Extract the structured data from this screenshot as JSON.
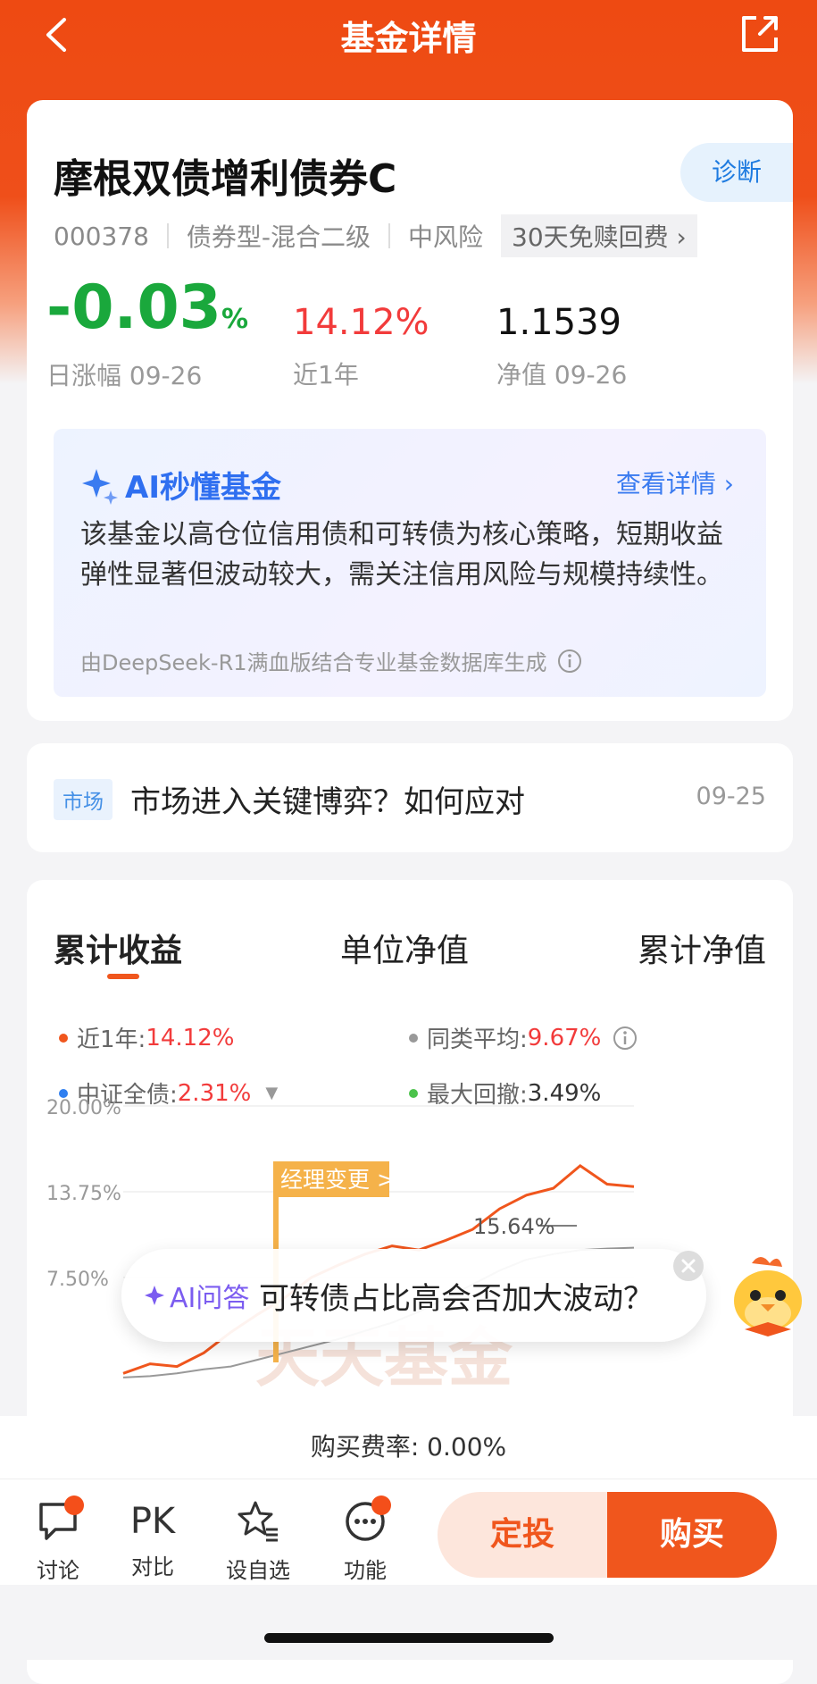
{
  "nav": {
    "title": "基金详情"
  },
  "fund": {
    "name": "摩根双债增利债券C",
    "diagnose_label": "诊断",
    "code": "000378",
    "type": "债券型-混合二级",
    "risk": "中风险",
    "fee_tag": "30天免赎回费",
    "daily_change": "-0.03",
    "daily_change_unit": "%",
    "daily_change_label": "日涨幅 09-26",
    "one_year": "14.12%",
    "one_year_label": "近1年",
    "nav_value": "1.1539",
    "nav_label": "净值 09-26"
  },
  "ai_summary": {
    "title": "AI秒懂基金",
    "more": "查看详情",
    "text": "该基金以高仓位信用债和可转债为核心策略，短期收益弹性显著但波动较大，需关注信用风险与规模持续性。",
    "source": "由DeepSeek-R1满血版结合专业基金数据库生成"
  },
  "news": {
    "tag": "市场",
    "title": "市场进入关键博弈？如何应对",
    "date": "09-25"
  },
  "chart_tabs": [
    "累计收益",
    "单位净值",
    "累计净值"
  ],
  "legend": {
    "fund": {
      "label": "近1年:",
      "value": "14.12%",
      "color": "#f0561d"
    },
    "peer": {
      "label": "同类平均:",
      "value": "9.67%",
      "color": "#999999"
    },
    "index": {
      "label": "中证全债:",
      "value": "2.31%",
      "color": "#2f7ff0"
    },
    "drawdown": {
      "label": "最大回撤:",
      "value": "3.49%",
      "color": "#4cc34c"
    }
  },
  "chart_data": {
    "type": "line",
    "yticks": [
      "20.00%",
      "13.75%",
      "7.50%"
    ],
    "ylim": [
      0,
      20
    ],
    "annotation": "经理变更 >",
    "peak_label": "15.64%",
    "watermark": "天天基金",
    "series": [
      {
        "values": [
          0.5,
          1.2,
          1.0,
          2.0,
          3.5,
          4.8,
          6.0,
          7.5,
          8.4,
          9.2,
          9.8,
          9.5,
          10.2,
          11.0,
          12.5,
          13.5,
          14.0,
          15.64,
          14.3,
          14.12
        ]
      },
      {
        "values": [
          0.2,
          0.3,
          0.5,
          0.8,
          1.0,
          1.5,
          2.0,
          2.5,
          3.0,
          3.6,
          4.2,
          5.0,
          6.0,
          7.0,
          8.0,
          8.8,
          9.2,
          9.5,
          9.6,
          9.67
        ]
      }
    ]
  },
  "ai_qa": {
    "label": "AI问答",
    "text": "可转债占比高会否加大波动？"
  },
  "fee_rate": "购买费率: 0.00%",
  "bottom_nav": [
    "讨论",
    "对比",
    "设自选",
    "功能"
  ],
  "pk_text": "PK",
  "buttons": {
    "fixed": "定投",
    "buy": "购买"
  }
}
